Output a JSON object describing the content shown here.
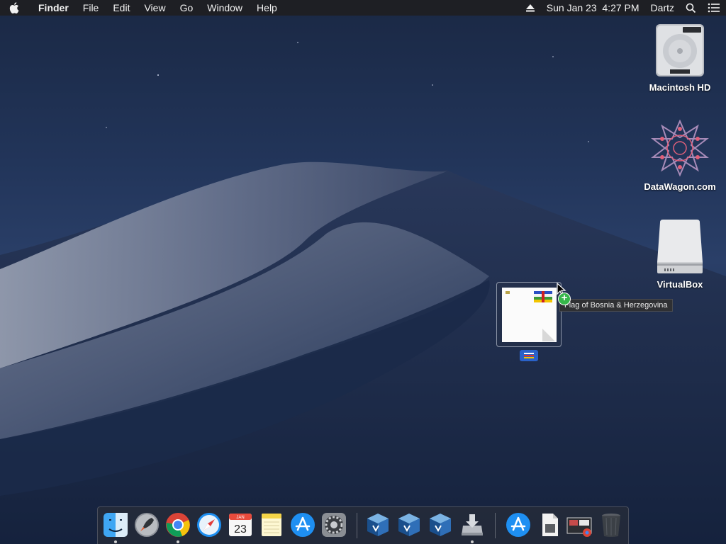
{
  "menubar": {
    "app_name": "Finder",
    "menus": [
      "File",
      "Edit",
      "View",
      "Go",
      "Window",
      "Help"
    ],
    "datetime": "Sun Jan 23  4:27 PM",
    "user": "Dartz"
  },
  "desktop": {
    "icons": [
      {
        "label": "Macintosh HD",
        "icon": "hard-drive-icon"
      },
      {
        "label": "DataWagon.com",
        "icon": "datawagon-logo-icon"
      },
      {
        "label": "VirtualBox",
        "icon": "external-drive-icon"
      }
    ]
  },
  "drag": {
    "tooltip": "Flag of Bosnia & Herzegovina",
    "badge_icon": "plus-copy-icon"
  },
  "dock": {
    "items": [
      {
        "name": "finder",
        "icon": "finder-icon",
        "running": true
      },
      {
        "name": "launchpad",
        "icon": "launchpad-icon",
        "running": false
      },
      {
        "name": "chrome",
        "icon": "chrome-icon",
        "running": true
      },
      {
        "name": "safari",
        "icon": "safari-icon",
        "running": false
      },
      {
        "name": "calendar",
        "icon": "calendar-icon",
        "running": false,
        "month": "JAN",
        "day": "23"
      },
      {
        "name": "notes",
        "icon": "notes-icon",
        "running": false
      },
      {
        "name": "app-store",
        "icon": "app-store-icon",
        "running": false
      },
      {
        "name": "system-preferences",
        "icon": "gear-icon",
        "running": false
      },
      {
        "name": "virtualbox-1",
        "icon": "virtualbox-icon",
        "running": false
      },
      {
        "name": "virtualbox-2",
        "icon": "virtualbox-icon",
        "running": false
      },
      {
        "name": "virtualbox-3",
        "icon": "virtualbox-icon",
        "running": false
      },
      {
        "name": "installer",
        "icon": "installer-icon",
        "running": true
      },
      {
        "name": "app-store-downloads",
        "icon": "app-store-icon",
        "running": false
      },
      {
        "name": "document-stack",
        "icon": "document-icon",
        "running": false
      },
      {
        "name": "screenshot-stack",
        "icon": "screenshot-icon",
        "running": false
      },
      {
        "name": "trash",
        "icon": "trash-icon",
        "running": false
      }
    ]
  },
  "colors": {
    "menubar_bg": "#1e1e22",
    "accent_green": "#36b64a",
    "wallpaper_dark": "#1a2844"
  }
}
